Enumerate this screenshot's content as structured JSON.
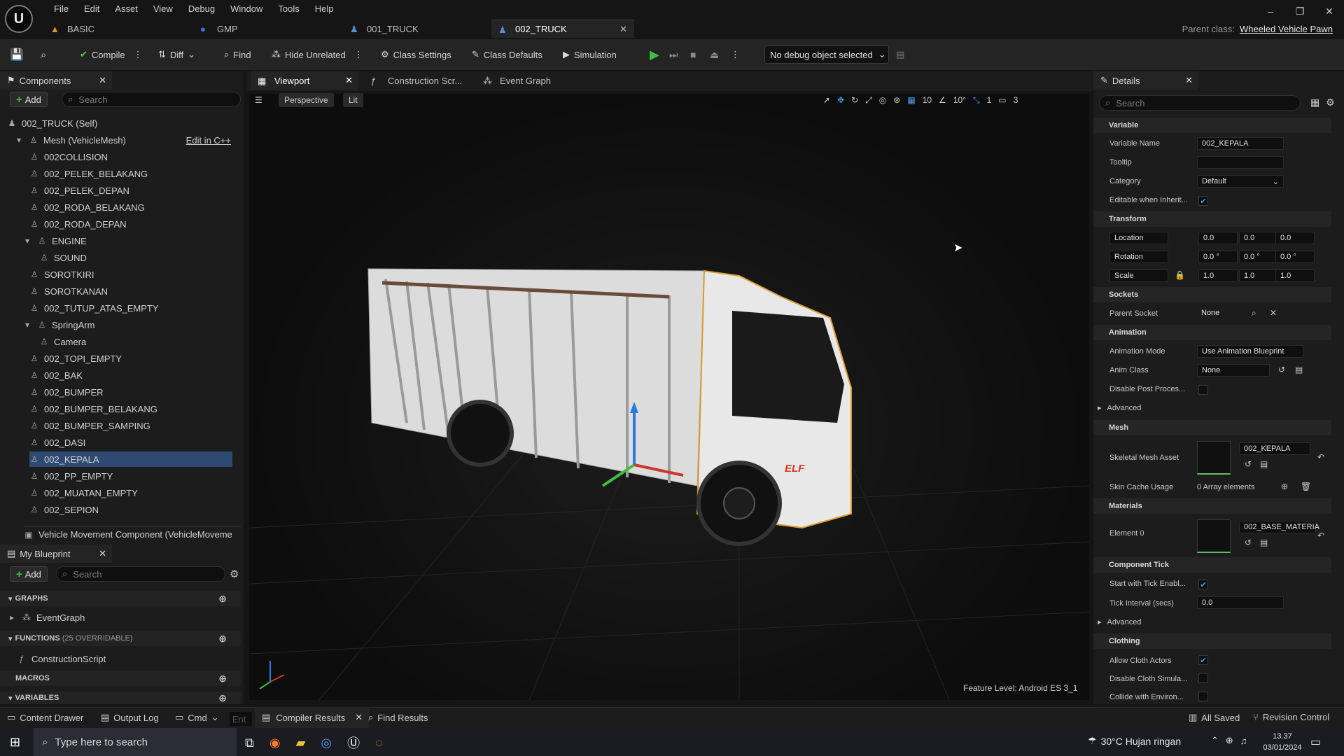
{
  "menu": [
    "File",
    "Edit",
    "Asset",
    "View",
    "Debug",
    "Window",
    "Tools",
    "Help"
  ],
  "tabs": [
    {
      "label": "BASIC"
    },
    {
      "label": "GMP"
    },
    {
      "label": "001_TRUCK"
    },
    {
      "label": "002_TRUCK"
    }
  ],
  "parent_class": {
    "label": "Parent class:",
    "value": "Wheeled Vehicle Pawn"
  },
  "toolbar": {
    "compile": "Compile",
    "diff": "Diff",
    "find": "Find",
    "hide_unrelated": "Hide Unrelated",
    "class_settings": "Class Settings",
    "class_defaults": "Class Defaults",
    "simulation": "Simulation",
    "debug_object": "No debug object selected"
  },
  "components": {
    "title": "Components",
    "add": "Add",
    "search_placeholder": "Search",
    "root": "002_TRUCK (Self)",
    "mesh": "Mesh (VehicleMesh)",
    "edit_cpp": "Edit in C++",
    "items": [
      "002COLLISION",
      "002_PELEK_BELAKANG",
      "002_PELEK_DEPAN",
      "002_RODA_BELAKANG",
      "002_RODA_DEPAN",
      "ENGINE",
      "SOUND",
      "SOROTKIRI",
      "SOROTKANAN",
      "002_TUTUP_ATAS_EMPTY",
      "SpringArm",
      "Camera",
      "002_TOPI_EMPTY",
      "002_BAK",
      "002_BUMPER",
      "002_BUMPER_BELAKANG",
      "002_BUMPER_SAMPING",
      "002_DASI",
      "002_KEPALA",
      "002_PP_EMPTY",
      "002_MUATAN_EMPTY",
      "002_SEPION"
    ],
    "selected": "002_KEPALA",
    "movement": "Vehicle Movement Component (VehicleMoveme"
  },
  "blueprint": {
    "title": "My Blueprint",
    "add": "Add",
    "search_placeholder": "Search",
    "graphs": "GRAPHS",
    "event_graph": "EventGraph",
    "functions": "FUNCTIONS",
    "functions_count": "(25 OVERRIDABLE)",
    "construction": "ConstructionScript",
    "macros": "MACROS",
    "variables": "VARIABLES"
  },
  "viewport_tabs": [
    "Viewport",
    "Construction Scr...",
    "Event Graph"
  ],
  "viewport": {
    "perspective": "Perspective",
    "lit": "Lit",
    "grid": "10",
    "angle": "10°",
    "scale_snap": "1",
    "cam_speed": "3",
    "feature_level": "Feature Level:  Android ES 3_1",
    "truck_logo": "ELF"
  },
  "details": {
    "title": "Details",
    "search_placeholder": "Search",
    "variable": "Variable",
    "variable_name_label": "Variable Name",
    "variable_name": "002_KEPALA",
    "tooltip_label": "Tooltip",
    "category_label": "Category",
    "category": "Default",
    "editable_label": "Editable when Inherit...",
    "transform": "Transform",
    "location": "Location",
    "rotation": "Rotation",
    "scale": "Scale",
    "loc": [
      "0.0",
      "0.0",
      "0.0"
    ],
    "rot": [
      "0.0 °",
      "0.0 °",
      "0.0 °"
    ],
    "scl": [
      "1.0",
      "1.0",
      "1.0"
    ],
    "sockets": "Sockets",
    "parent_socket_label": "Parent Socket",
    "parent_socket": "None",
    "animation": "Animation",
    "anim_mode_label": "Animation Mode",
    "anim_mode": "Use Animation Blueprint",
    "anim_class_label": "Anim Class",
    "anim_class": "None",
    "disable_post_label": "Disable Post Proces...",
    "advanced": "Advanced",
    "mesh": "Mesh",
    "skeletal_label": "Skeletal Mesh Asset",
    "skeletal": "002_KEPALA",
    "skin_cache_label": "Skin Cache Usage",
    "skin_cache": "0 Array elements",
    "materials": "Materials",
    "element0_label": "Element 0",
    "element0": "002_BASE_MATERIA",
    "component_tick": "Component Tick",
    "start_tick_label": "Start with Tick Enabl...",
    "tick_interval_label": "Tick Interval (secs)",
    "tick_interval": "0.0",
    "advanced2": "Advanced",
    "clothing": "Clothing",
    "allow_cloth_label": "Allow Cloth Actors",
    "disable_cloth_label": "Disable Cloth Simula...",
    "collide_label": "Collide with Environ..."
  },
  "statusbar": {
    "content_drawer": "Content Drawer",
    "output_log": "Output Log",
    "cmd": "Cmd",
    "console_placeholder": "Ent",
    "compiler_results": "Compiler Results",
    "find_results": "Find Results",
    "all_saved": "All Saved",
    "revision": "Revision Control"
  },
  "taskbar": {
    "search_placeholder": "Type here to search",
    "weather": "30°C  Hujan ringan",
    "time": "13.37",
    "date": "03/01/2024"
  }
}
